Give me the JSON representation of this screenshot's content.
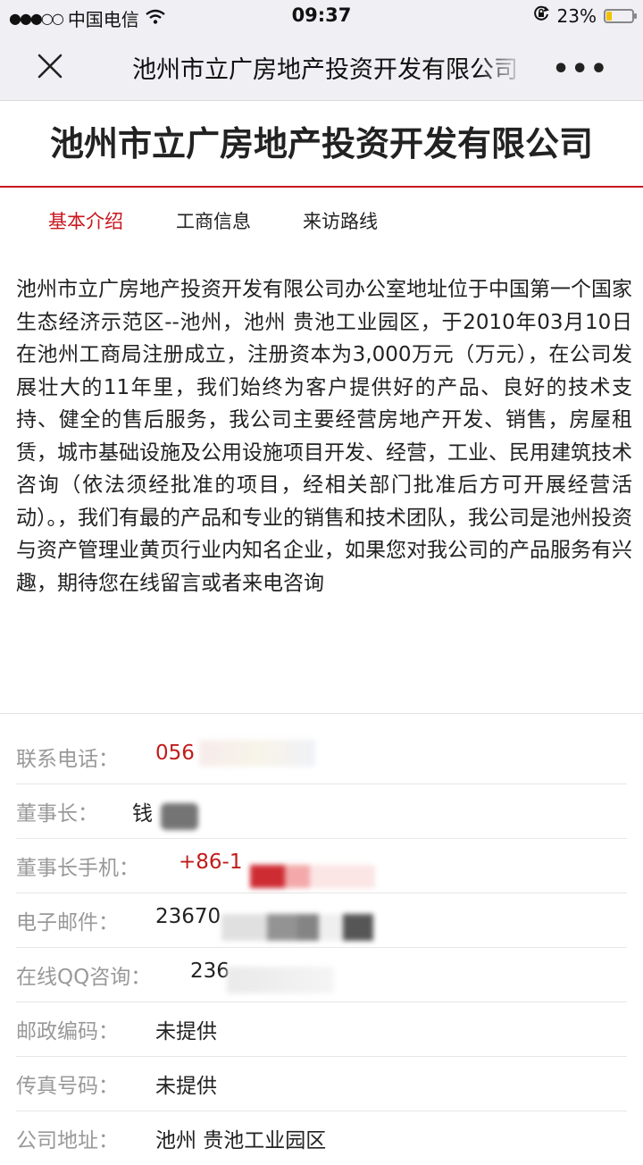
{
  "status_bar": {
    "signal_dots": "●●●○○",
    "carrier": "中国电信",
    "time": "09:37",
    "battery_percent": "23%",
    "battery_level": 0.23
  },
  "nav": {
    "title": "池州市立广房地产投资开发有限公司",
    "more_label": "•••"
  },
  "company": {
    "name": "池州市立广房地产投资开发有限公司"
  },
  "tabs": [
    {
      "label": "基本介绍",
      "active": true
    },
    {
      "label": "工商信息",
      "active": false
    },
    {
      "label": "来访路线",
      "active": false
    }
  ],
  "description": "池州市立广房地产投资开发有限公司办公室地址位于中国第一个国家生态经济示范区--池州，池州 贵池工业园区，于2010年03月10日在池州工商局注册成立，注册资本为3,000万元（万元），在公司发展壮大的11年里，我们始终为客户提供好的产品、良好的技术支持、健全的售后服务，我公司主要经营房地产开发、销售，房屋租赁，城市基础设施及公用设施项目开发、经营，工业、民用建筑技术咨询（依法须经批准的项目，经相关部门批准后方可开展经营活动）。，我们有最的产品和专业的销售和技术团队，我公司是池州投资与资产管理业黄页行业内知名企业，如果您对我公司的产品服务有兴趣，期待您在线留言或者来电咨询",
  "info": {
    "phone": {
      "label": "联系电话：",
      "value": "056"
    },
    "chairman": {
      "label": "董事长：",
      "value": "钱"
    },
    "chairman_mobile": {
      "label": "董事长手机：",
      "value": "+86-1"
    },
    "email": {
      "label": "电子邮件：",
      "value": "23670"
    },
    "qq": {
      "label": "在线QQ咨询：",
      "value": "236"
    },
    "postcode": {
      "label": "邮政编码：",
      "value": "未提供"
    },
    "fax": {
      "label": "传真号码：",
      "value": "未提供"
    },
    "address": {
      "label": "公司地址：",
      "value": "池州 贵池工业园区"
    }
  },
  "colors": {
    "accent_red": "#c9161d",
    "label_gray": "#999999",
    "nav_bg": "#efeff4"
  }
}
